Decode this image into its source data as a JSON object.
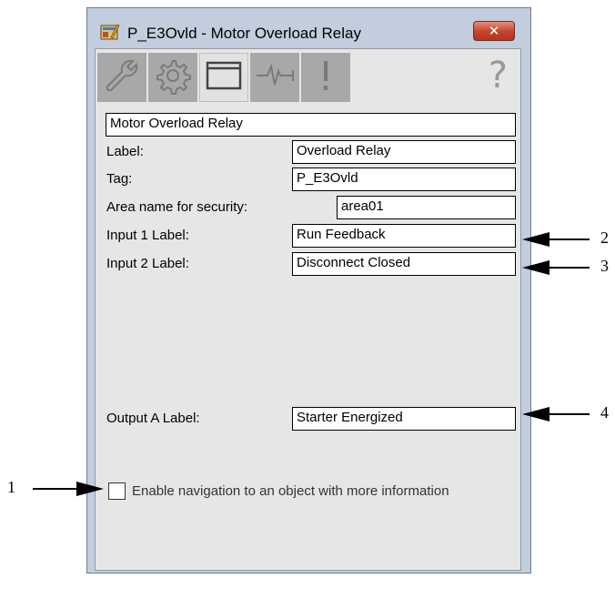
{
  "window": {
    "title": "P_E3Ovld - Motor Overload Relay",
    "close_label": "✕"
  },
  "toolbar": {
    "tabs": [
      {
        "icon": "wrench-icon",
        "active": false
      },
      {
        "icon": "gear-icon",
        "active": false
      },
      {
        "icon": "window-icon",
        "active": true
      },
      {
        "icon": "trend-icon",
        "active": false
      },
      {
        "icon": "alarm-icon",
        "active": false
      }
    ],
    "help_label": "?"
  },
  "form": {
    "description": "Motor Overload Relay",
    "label_caption": "Label:",
    "label_value": "Overload Relay",
    "tag_caption": "Tag:",
    "tag_value": "P_E3Ovld",
    "area_caption": "Area name for security:",
    "area_value": "area01",
    "input1_caption": "Input 1 Label:",
    "input1_value": "Run Feedback",
    "input2_caption": "Input 2 Label:",
    "input2_value": "Disconnect Closed",
    "outputA_caption": "Output A Label:",
    "outputA_value": "Starter Energized",
    "nav_checkbox_label": "Enable navigation to an object with more information",
    "nav_checkbox_checked": false
  },
  "callouts": {
    "one": "1",
    "two": "2",
    "three": "3",
    "four": "4"
  }
}
